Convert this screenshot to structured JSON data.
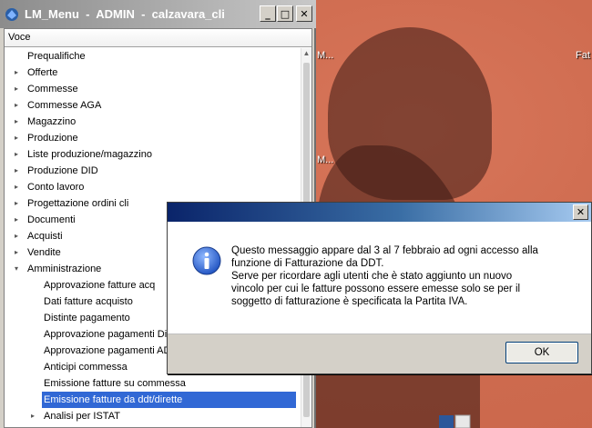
{
  "desktop": {
    "labels": [
      "M...",
      "Fat",
      "M..."
    ]
  },
  "window": {
    "title": "LM_Menu  -  ADMIN  -  calzavara_cli",
    "column_header": "Voce",
    "buttons": {
      "minimize": "_",
      "maximize": "□",
      "close": "✕"
    }
  },
  "tree": {
    "items": [
      {
        "label": "Prequalifiche",
        "arrow": ""
      },
      {
        "label": "Offerte",
        "arrow": "▸"
      },
      {
        "label": "Commesse",
        "arrow": "▸"
      },
      {
        "label": "Commesse AGA",
        "arrow": "▸"
      },
      {
        "label": "Magazzino",
        "arrow": "▸"
      },
      {
        "label": "Produzione",
        "arrow": "▸"
      },
      {
        "label": "Liste produzione/magazzino",
        "arrow": "▸"
      },
      {
        "label": "Produzione DID",
        "arrow": "▸"
      },
      {
        "label": "Conto lavoro",
        "arrow": "▸"
      },
      {
        "label": "Progettazione ordini cli",
        "arrow": "▸"
      },
      {
        "label": "Documenti",
        "arrow": "▸"
      },
      {
        "label": "Acquisti",
        "arrow": "▸"
      },
      {
        "label": "Vendite",
        "arrow": "▸"
      },
      {
        "label": "Amministrazione",
        "arrow": "▾"
      }
    ],
    "subitems": [
      {
        "label": "Approvazione fatture acq",
        "arrow": ""
      },
      {
        "label": "Dati fatture acquisto",
        "arrow": ""
      },
      {
        "label": "Distinte pagamento",
        "arrow": ""
      },
      {
        "label": "Approvazione pagamenti Dir",
        "arrow": ""
      },
      {
        "label": "Approvazione pagamenti AD",
        "arrow": ""
      },
      {
        "label": "Anticipi commessa",
        "arrow": ""
      },
      {
        "label": "Emissione fatture su commessa",
        "arrow": ""
      },
      {
        "label": "Emissione fatture da ddt/dirette",
        "arrow": "",
        "selected": true
      },
      {
        "label": "Analisi per ISTAT",
        "arrow": "▸"
      }
    ]
  },
  "dialog": {
    "close": "✕",
    "message_lines": [
      "Questo messaggio appare dal 3 al 7 febbraio ad ogni accesso alla",
      "funzione di Fatturazione da DDT.",
      "Serve per ricordare agli utenti che è stato aggiunto un nuovo",
      "vincolo per cui le fatture possono essere emesse solo se per il",
      "soggetto di fatturazione è specificata la Partita IVA."
    ],
    "ok_label": "OK"
  },
  "colors": {
    "selection": "#3168d5",
    "dialog_title": "#0a246a",
    "desktop": "#cf6c50"
  }
}
